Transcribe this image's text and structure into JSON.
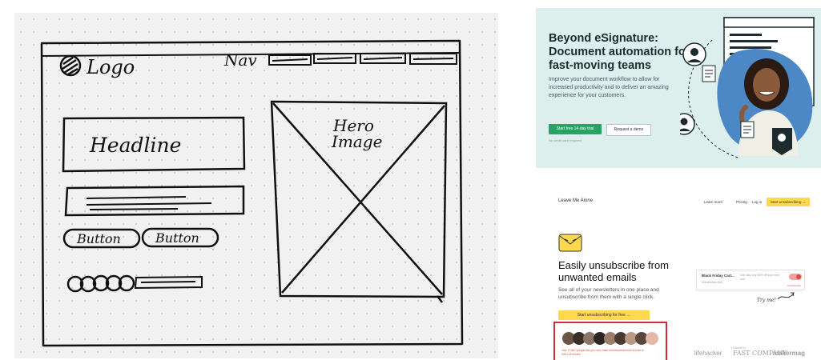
{
  "sketch": {
    "logo": "Logo",
    "nav": "Nav",
    "headline": "Headline",
    "hero_line1": "Hero",
    "hero_line2": "Image",
    "button1": "Button",
    "button2": "Button"
  },
  "esign": {
    "headline": "Beyond eSignature: Document automation for fast-moving teams",
    "body": "Improve your document workflow to allow for increased productivity and to deliver an amazing experience for your customers.",
    "cta_primary": "Start free 14-day trial",
    "cta_secondary": "Request a demo",
    "note": "No credit card required",
    "colors": {
      "background": "#dcefed",
      "primary": "#25a464"
    }
  },
  "lma": {
    "brand": "Leave Me Alone",
    "nav": [
      "Learn more",
      "Pricing",
      "Log in"
    ],
    "nav_cta": "Start unsubscribing →",
    "headline": "Easily unsubscribe from unwanted emails",
    "subtext": "See all of your newsletters in one place and unsubscribe from them with a single click.",
    "cta": "Start unsubscribing for free →",
    "card_title": "Black Friday Cart...",
    "card_sub": "hello@shop.com",
    "card_desc": "One day only 30% off your next cart",
    "card_tag": "Unsubscribe",
    "try_me": "Try me!",
    "social_proof": "Join 17,867 people like you who have unsubscribed from a total of 545,118 emails",
    "featured_label": "Featured in",
    "press": [
      "lifehacker",
      "FAST COMPANY",
      "makermag"
    ],
    "colors": {
      "cta": "#ffd84d",
      "highlight": "#d42a3a"
    }
  }
}
